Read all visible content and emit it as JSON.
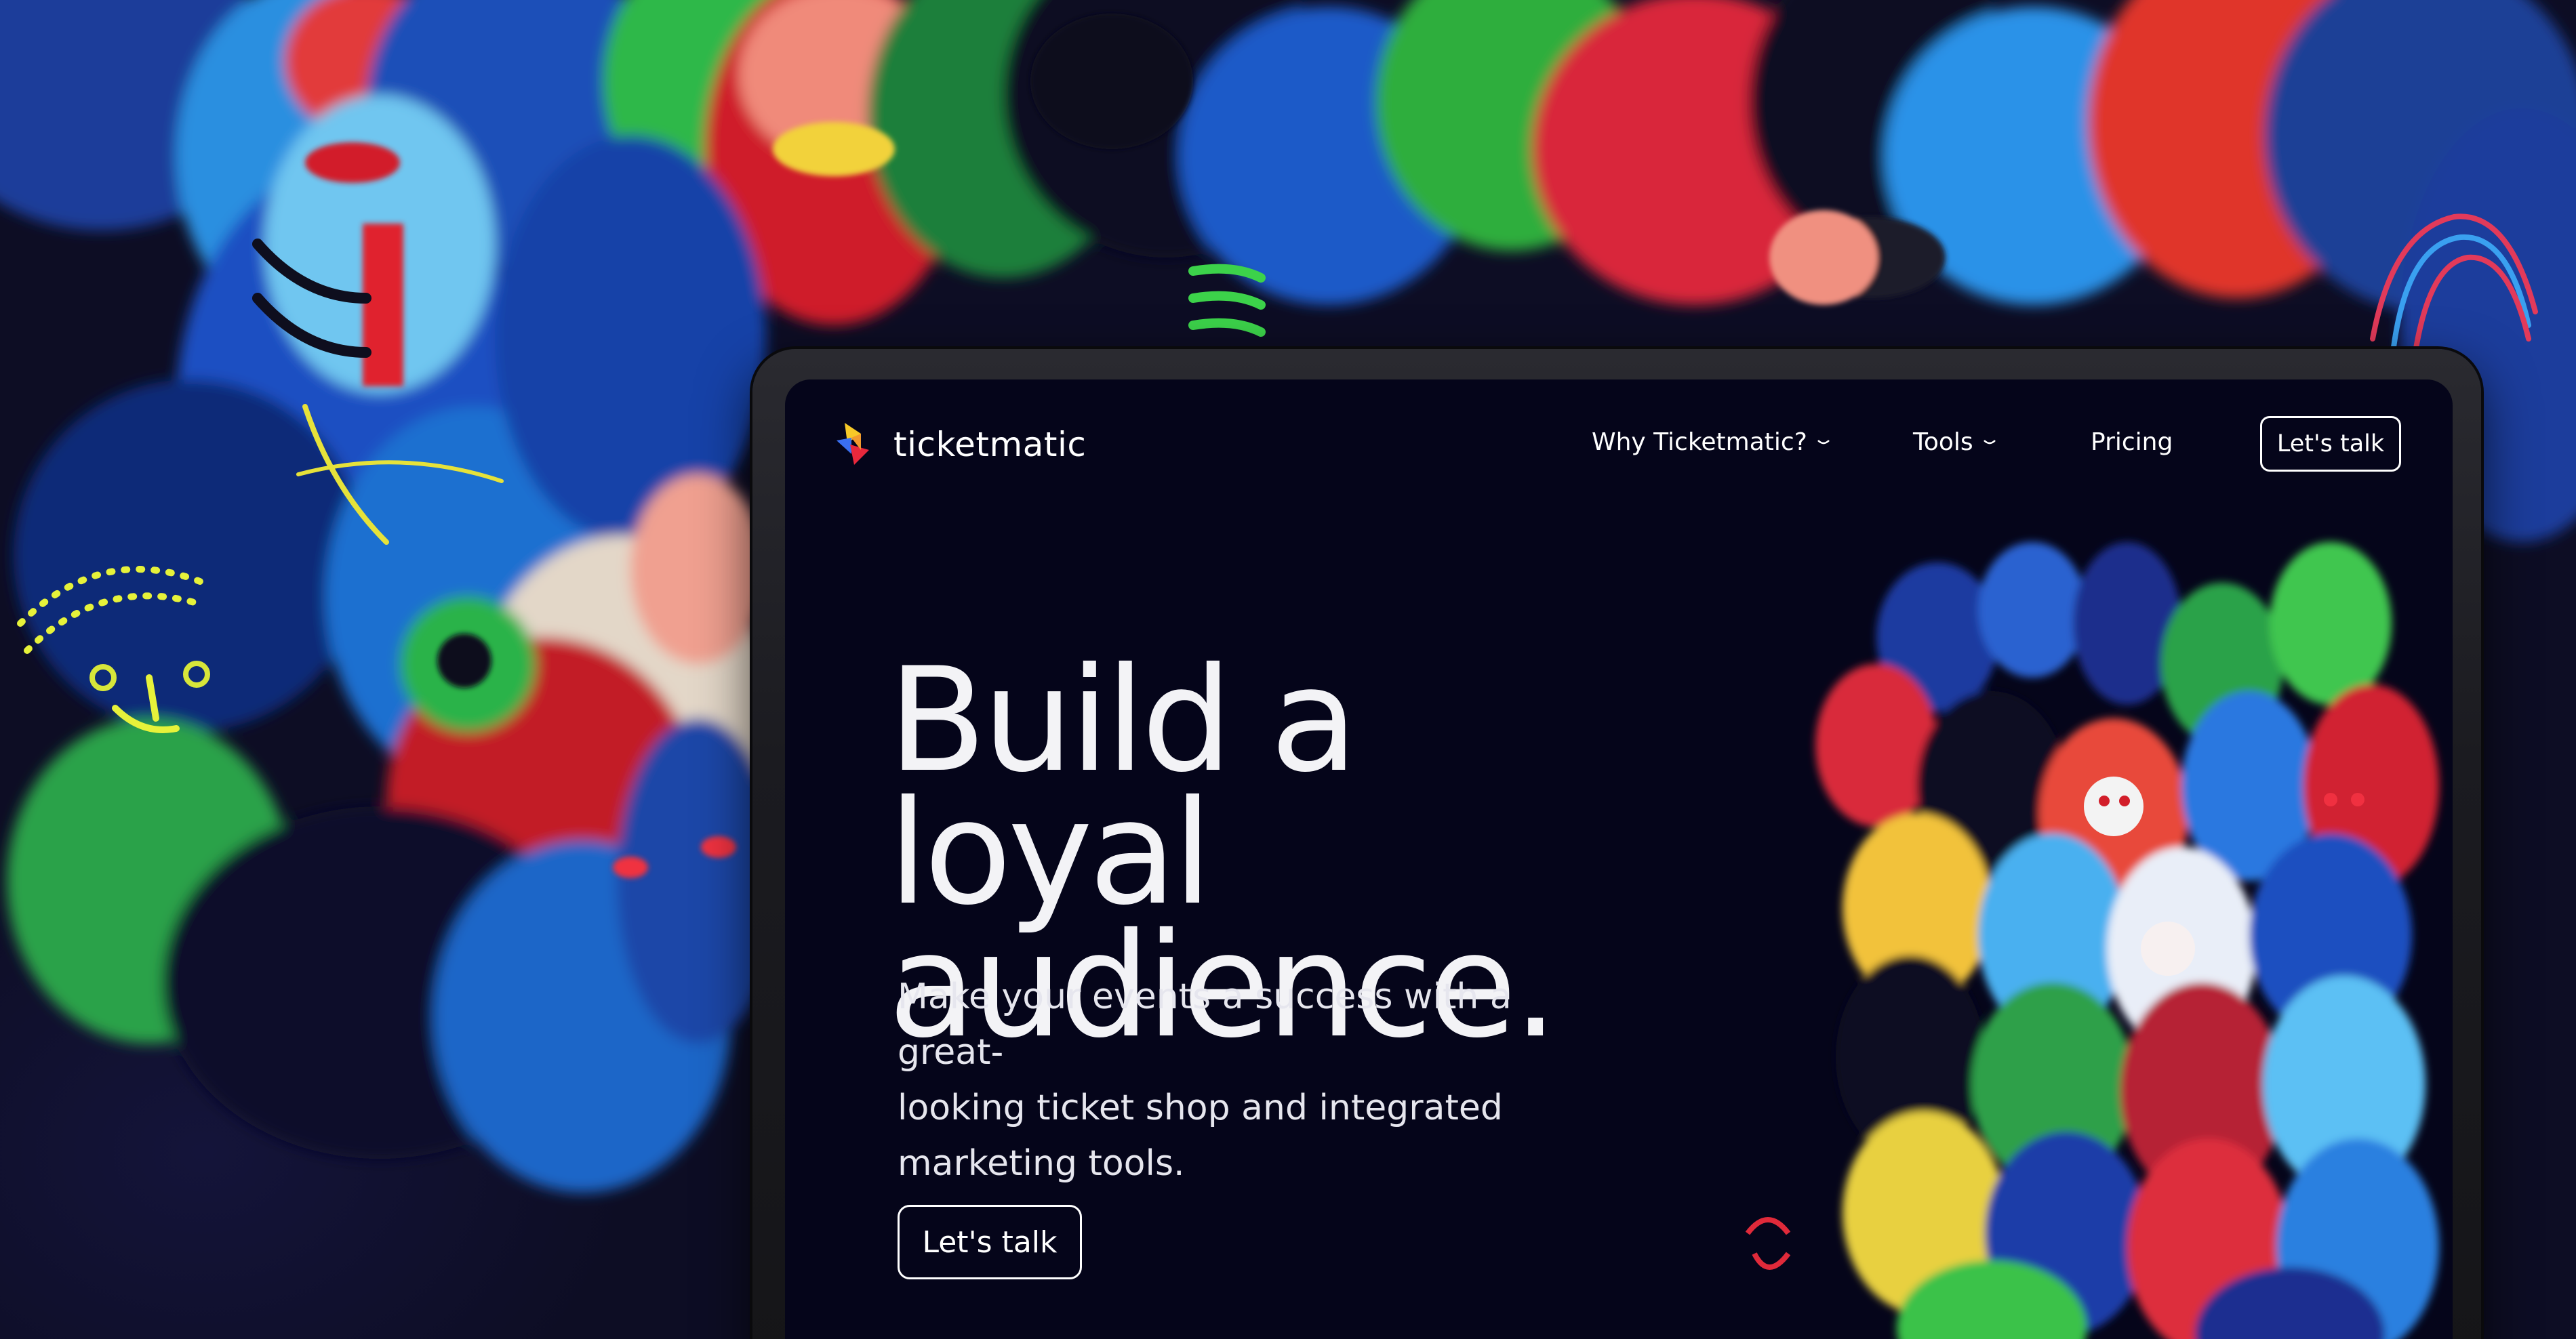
{
  "brand": {
    "name": "ticketmatic",
    "logo_icon": "ticketmatic-logo-icon"
  },
  "nav": {
    "items": [
      {
        "label": "Why Ticketmatic?",
        "has_dropdown": true
      },
      {
        "label": "Tools",
        "has_dropdown": true
      },
      {
        "label": "Pricing",
        "has_dropdown": false
      }
    ],
    "cta_label": "Let's talk"
  },
  "hero": {
    "title_line1": "Build a loyal",
    "title_line2": "audience.",
    "subtitle_line1": "Make your events a success with a great-",
    "subtitle_line2": "looking ticket shop and integrated",
    "subtitle_line3": "marketing tools.",
    "cta_label": "Let's talk"
  },
  "colors": {
    "page_background": "#0d0d24",
    "screen_background": "#05051a",
    "text": "#ffffff",
    "logo_yellow": "#f7c928",
    "logo_red": "#e8283c",
    "logo_blue": "#3a6ff0"
  }
}
